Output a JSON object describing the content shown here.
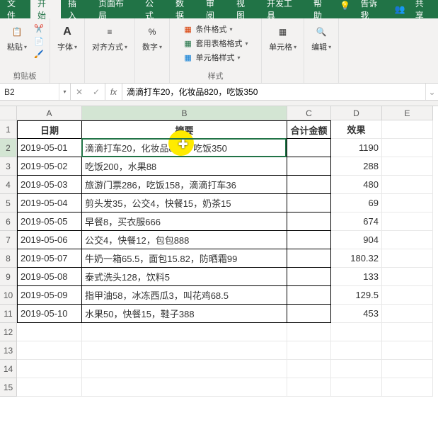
{
  "ribbon": {
    "tabs": [
      "文件",
      "开始",
      "插入",
      "页面布局",
      "公式",
      "数据",
      "审阅",
      "视图",
      "开发工具",
      "帮助"
    ],
    "active_tab": 1,
    "tell_me": "告诉我",
    "share": "共享",
    "groups": {
      "clipboard": {
        "label": "剪贴板",
        "paste": "粘贴"
      },
      "font": {
        "label": "字体"
      },
      "align": {
        "label": "对齐方式"
      },
      "number": {
        "label": "数字"
      },
      "styles": {
        "label": "样式",
        "cond": "条件格式",
        "table": "套用表格格式",
        "cell": "单元格样式"
      },
      "cells": {
        "label": "单元格"
      },
      "edit": {
        "label": "编辑"
      }
    }
  },
  "formula_bar": {
    "cell_ref": "B2",
    "formula": "滴滴打车20，化妆品820，吃饭350"
  },
  "sheet": {
    "columns": [
      "A",
      "B",
      "C",
      "D",
      "E"
    ],
    "headers": {
      "A": "日期",
      "B": "摘要",
      "C": "合计金额",
      "D": "效果"
    },
    "rows": [
      {
        "A": "2019-05-01",
        "B": "滴滴打车20，化妆品820，吃饭350",
        "C": "",
        "D": "1190"
      },
      {
        "A": "2019-05-02",
        "B": "吃饭200，水果88",
        "C": "",
        "D": "288"
      },
      {
        "A": "2019-05-03",
        "B": "旅游门票286，吃饭158，滴滴打车36",
        "C": "",
        "D": "480"
      },
      {
        "A": "2019-05-04",
        "B": "剪头发35，公交4，快餐15，奶茶15",
        "C": "",
        "D": "69"
      },
      {
        "A": "2019-05-05",
        "B": "早餐8，买衣服666",
        "C": "",
        "D": "674"
      },
      {
        "A": "2019-05-06",
        "B": "公交4，快餐12，包包888",
        "C": "",
        "D": "904"
      },
      {
        "A": "2019-05-07",
        "B": "牛奶一箱65.5，面包15.82，防晒霜99",
        "C": "",
        "D": "180.32"
      },
      {
        "A": "2019-05-08",
        "B": "泰式洗头128，饮料5",
        "C": "",
        "D": "133"
      },
      {
        "A": "2019-05-09",
        "B": "指甲油58，冰冻西瓜3，叫花鸡68.5",
        "C": "",
        "D": "129.5"
      },
      {
        "A": "2019-05-10",
        "B": "水果50，快餐15，鞋子388",
        "C": "",
        "D": "453"
      }
    ],
    "active_cell": "B2",
    "total_rows_shown": 15
  }
}
